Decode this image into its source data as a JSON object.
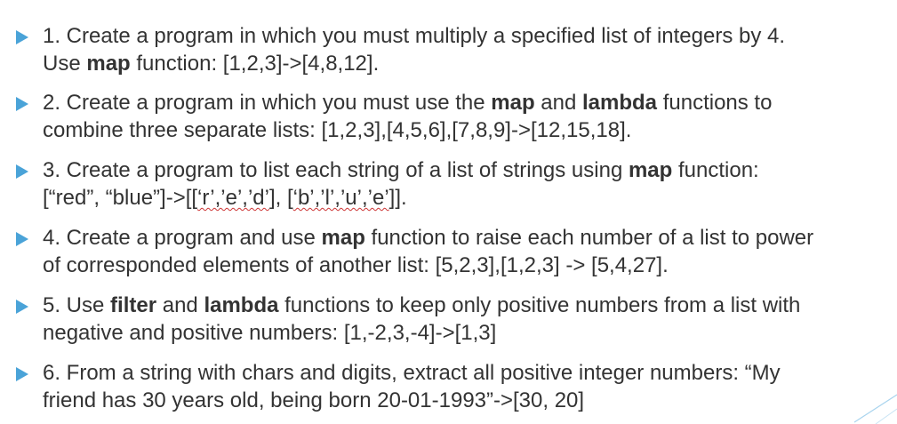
{
  "exercises": [
    {
      "line1": [
        "1. Create a program in which you must multiply a specified list of integers by 4."
      ],
      "line2": [
        "Use ",
        "map",
        " function: [1,2,3]->[4,8,12]."
      ]
    },
    {
      "line1": [
        "2. Create a program in which you must use the ",
        "map",
        " and ",
        "lambda",
        " functions to"
      ],
      "line2": [
        "combine three separate lists: [1,2,3],[4,5,6],[7,8,9]->[12,15,18]."
      ]
    },
    {
      "line1": [
        "3. Create a program to list each string of a list of strings using ",
        "map",
        " function:"
      ],
      "line2": [
        "[“red”, “blue”]->[[",
        "‘r’,’e’,’d’",
        "], [",
        "‘b’,’l’,’u’,’e’",
        "]]."
      ]
    },
    {
      "line1": [
        "4. Create a program and use ",
        "map",
        " function to raise each number of a list to power"
      ],
      "line2": [
        "of corresponded elements of another list: [5,2,3],[1,2,3] -> [5,4,27]."
      ]
    },
    {
      "line1": [
        "5. Use ",
        "filter",
        " and ",
        "lambda",
        " functions to keep only positive numbers from a list with"
      ],
      "line2": [
        "negative and positive numbers: [1,-2,3,-4]->[1,3]"
      ]
    },
    {
      "line1": [
        "6. From a string with chars and digits, extract all positive integer numbers: “My"
      ],
      "line2": [
        "friend has 30 years old, being born 20-01-1993”->[30, 20]"
      ]
    }
  ],
  "colors": {
    "bullet": "#4aa3d8",
    "text": "#333333",
    "spellcheck": "#cc3333"
  },
  "icons": {
    "bullet": "triangle-bullet-icon",
    "corner": "corner-decoration-icon"
  }
}
